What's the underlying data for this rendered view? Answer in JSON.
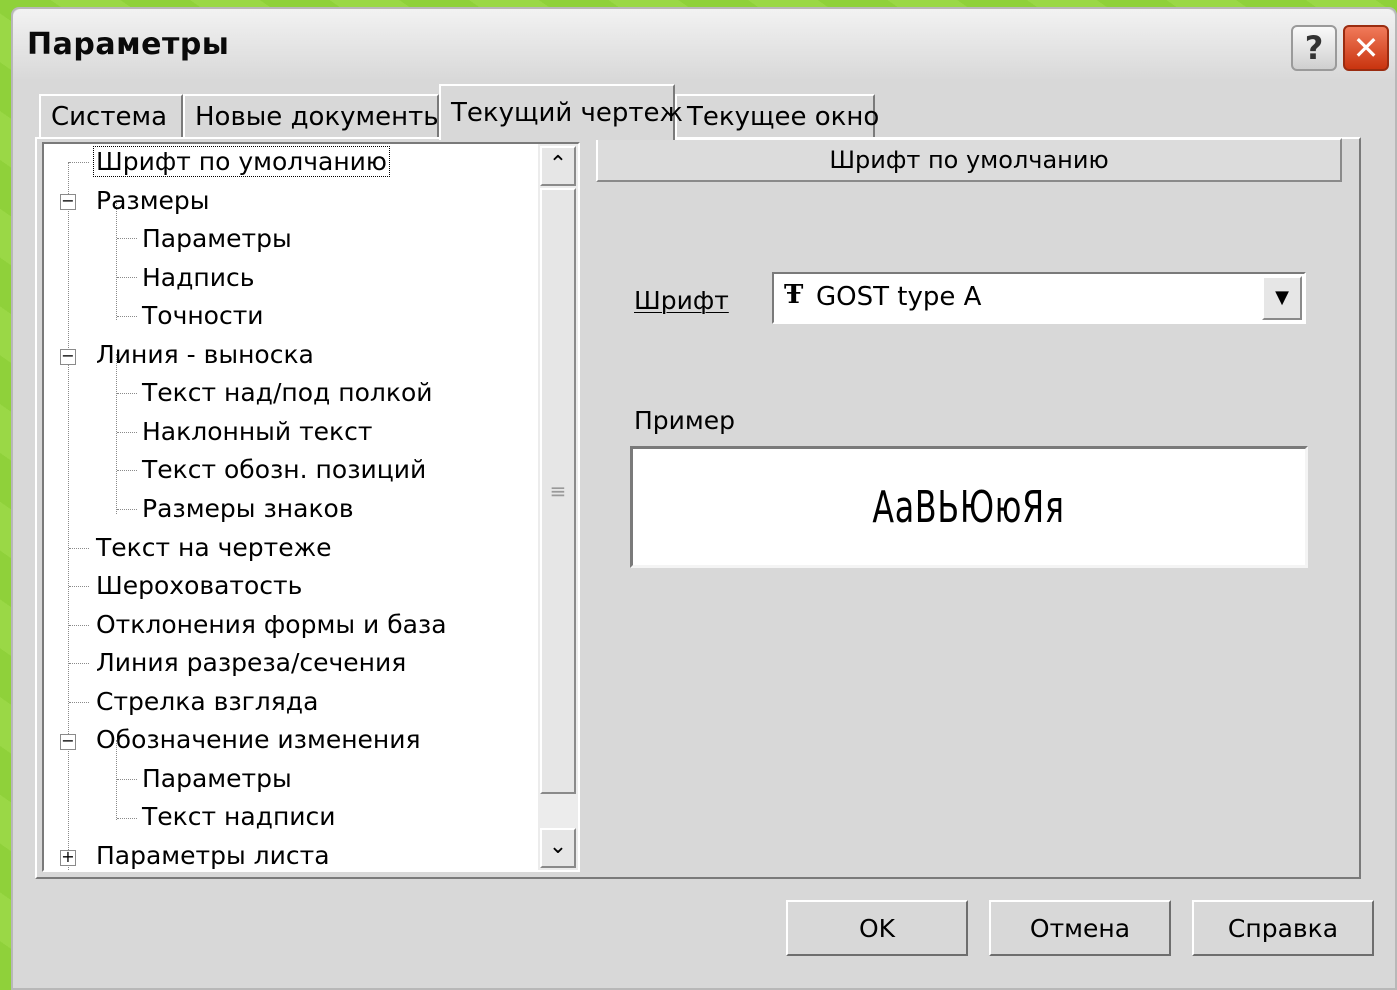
{
  "window": {
    "title": "Параметры"
  },
  "titlebar": {
    "help_label": "?",
    "close_label": "✕"
  },
  "tabs": [
    {
      "label": "Система",
      "active": false
    },
    {
      "label": "Новые документы",
      "active": false
    },
    {
      "label": "Текущий чертеж",
      "active": true
    },
    {
      "label": "Текущее окно",
      "active": false
    }
  ],
  "tree": {
    "items": [
      {
        "label": "Шрифт по умолчанию",
        "level": 0,
        "selected": true
      },
      {
        "label": "Размеры",
        "level": 0,
        "expander": "−"
      },
      {
        "label": "Параметры",
        "level": 1
      },
      {
        "label": "Надпись",
        "level": 1
      },
      {
        "label": "Точности",
        "level": 1
      },
      {
        "label": "Линия - выноска",
        "level": 0,
        "expander": "−"
      },
      {
        "label": "Текст над/под полкой",
        "level": 1
      },
      {
        "label": "Наклонный текст",
        "level": 1
      },
      {
        "label": "Текст обозн. позиций",
        "level": 1
      },
      {
        "label": "Размеры знаков",
        "level": 1
      },
      {
        "label": "Текст на чертеже",
        "level": 0
      },
      {
        "label": "Шероховатость",
        "level": 0
      },
      {
        "label": "Отклонения формы и база",
        "level": 0
      },
      {
        "label": "Линия разреза/сечения",
        "level": 0
      },
      {
        "label": "Стрелка взгляда",
        "level": 0
      },
      {
        "label": "Обозначение изменения",
        "level": 0,
        "expander": "−"
      },
      {
        "label": "Параметры",
        "level": 1
      },
      {
        "label": "Текст надписи",
        "level": 1
      },
      {
        "label": "Параметры листа",
        "level": 0,
        "expander": "+"
      }
    ],
    "scroll_up": "⌃",
    "scroll_down": "⌄",
    "thumb_grip": "≡"
  },
  "settings": {
    "section_title": "Шрифт по умолчанию",
    "font_label": "Шрифт",
    "font_value": "GOST type A",
    "font_icon": "Ŧ",
    "sample_label": "Пример",
    "sample_text": "АаВЬЮюЯя",
    "dropdown_arrow": "▼"
  },
  "buttons": {
    "ok": "OK",
    "cancel": "Отмена",
    "help": "Справка"
  }
}
